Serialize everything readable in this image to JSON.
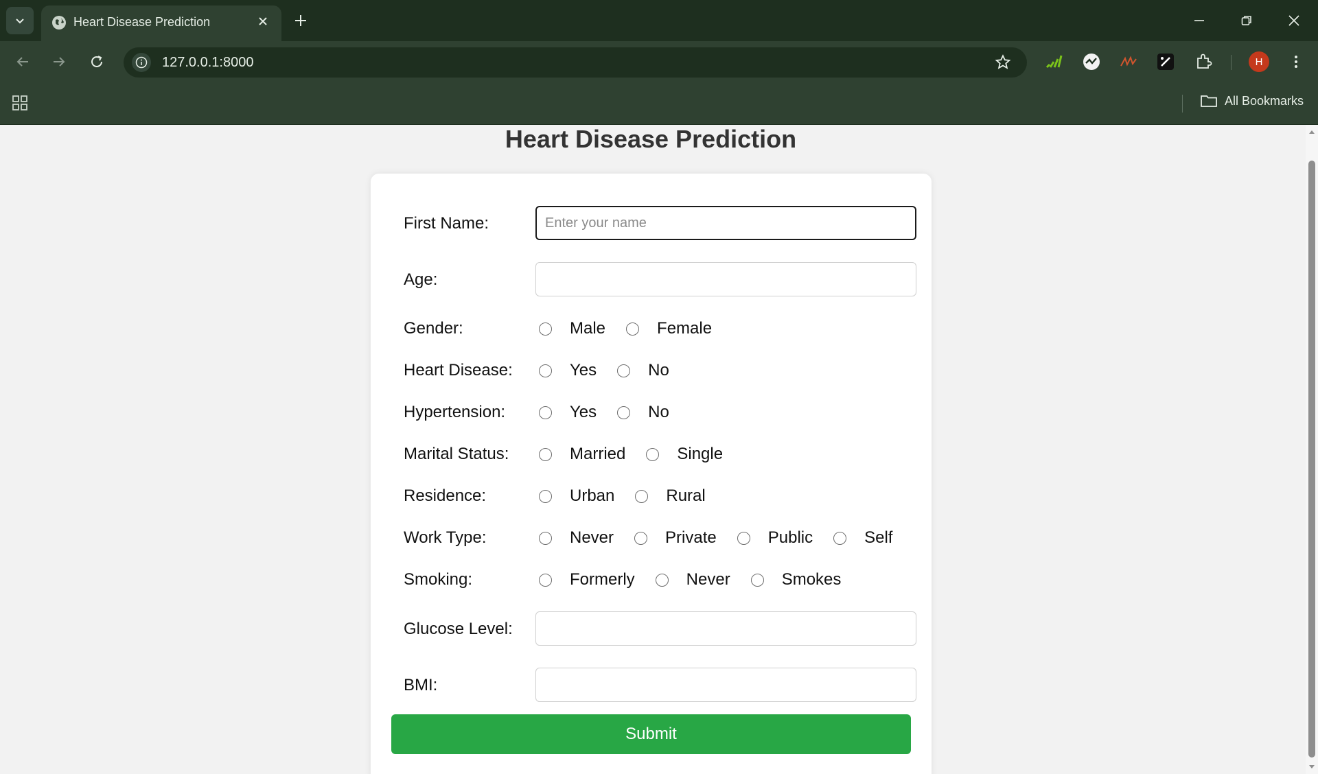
{
  "browser": {
    "tab": {
      "title": "Heart Disease Prediction"
    },
    "address_bar": {
      "url": "127.0.0.1:8000"
    },
    "bookmarks_bar": {
      "all_bookmarks_label": "All Bookmarks"
    },
    "profile": {
      "initial": "H",
      "color": "#c5391c"
    }
  },
  "page": {
    "heading": "Heart Disease Prediction",
    "form": {
      "first_name": {
        "label": "First Name:",
        "placeholder": "Enter your name",
        "value": ""
      },
      "age": {
        "label": "Age:",
        "value": ""
      },
      "gender": {
        "label": "Gender:",
        "options": [
          "Male",
          "Female"
        ]
      },
      "heart_disease": {
        "label": "Heart Disease:",
        "options": [
          "Yes",
          "No"
        ]
      },
      "hypertension": {
        "label": "Hypertension:",
        "options": [
          "Yes",
          "No"
        ]
      },
      "marital_status": {
        "label": "Marital Status:",
        "options": [
          "Married",
          "Single"
        ]
      },
      "residence": {
        "label": "Residence:",
        "options": [
          "Urban",
          "Rural"
        ]
      },
      "work_type": {
        "label": "Work Type:",
        "options": [
          "Never",
          "Private",
          "Public",
          "Self"
        ]
      },
      "smoking": {
        "label": "Smoking:",
        "options": [
          "Formerly",
          "Never",
          "Smokes"
        ]
      },
      "glucose_level": {
        "label": "Glucose Level:",
        "value": ""
      },
      "bmi": {
        "label": "BMI:",
        "value": ""
      },
      "submit_label": "Submit"
    }
  },
  "colors": {
    "chrome_dark": "#1e2f1f",
    "chrome": "#2f4131",
    "submit": "#28a745"
  }
}
